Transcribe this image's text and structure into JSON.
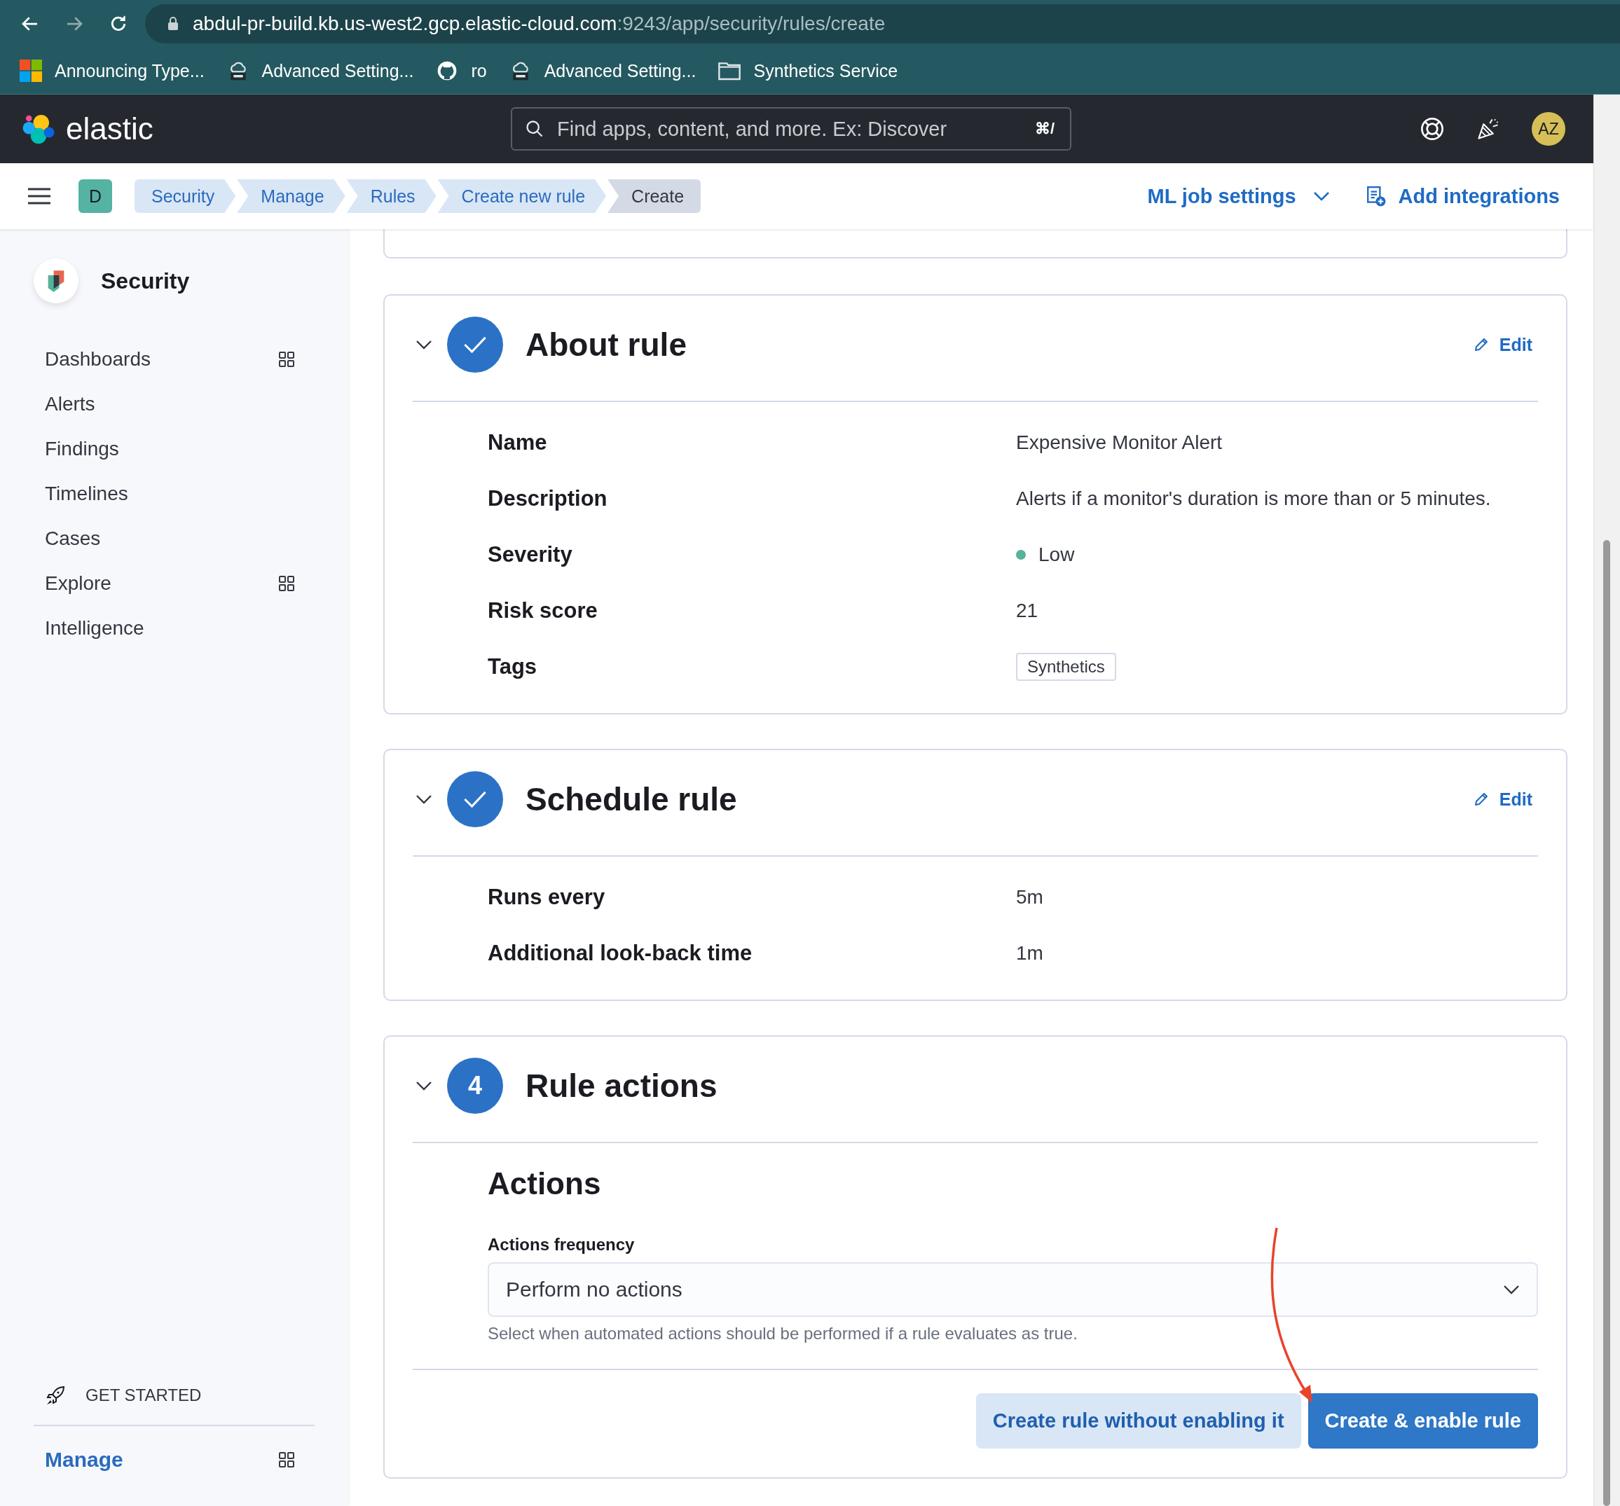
{
  "browser": {
    "url_host": "abdul-pr-build.kb.us-west2.gcp.elastic-cloud.com",
    "url_path": ":9243/app/security/rules/create",
    "bookmarks": [
      {
        "label": "Announcing Type...",
        "kind": "tiles"
      },
      {
        "label": "Advanced Setting...",
        "kind": "dev"
      },
      {
        "label": "ro",
        "kind": "github"
      },
      {
        "label": "Advanced Setting...",
        "kind": "dev"
      },
      {
        "label": "Synthetics Service",
        "kind": "folder"
      }
    ]
  },
  "header": {
    "logo_text": "elastic",
    "search": {
      "placeholder": "Find apps, content, and more. Ex: Discover",
      "shortcut": "⌘/"
    },
    "avatar": "AZ"
  },
  "breadcrumb_bar": {
    "space": "D",
    "crumbs": [
      {
        "label": "Security",
        "selected": false
      },
      {
        "label": "Manage",
        "selected": false
      },
      {
        "label": "Rules",
        "selected": false
      },
      {
        "label": "Create new rule",
        "selected": false
      },
      {
        "label": "Create",
        "selected": true
      }
    ],
    "links": [
      {
        "label": "ML job settings",
        "kind": "dropdown"
      },
      {
        "label": "Add integrations",
        "kind": "integrations"
      }
    ]
  },
  "sidebar": {
    "title": "Security",
    "items": [
      {
        "label": "Dashboards",
        "grid": true
      },
      {
        "label": "Alerts",
        "grid": false
      },
      {
        "label": "Findings",
        "grid": false
      },
      {
        "label": "Timelines",
        "grid": false
      },
      {
        "label": "Cases",
        "grid": false
      },
      {
        "label": "Explore",
        "grid": true
      },
      {
        "label": "Intelligence",
        "grid": false
      }
    ],
    "get_started": "GET STARTED",
    "manage": {
      "label": "Manage",
      "selected": true,
      "grid": true
    }
  },
  "sections": [
    {
      "title": "About rule",
      "completed": true,
      "edit": "Edit",
      "fields": [
        {
          "label": "Name",
          "value": "Expensive Monitor Alert",
          "kind": "text"
        },
        {
          "label": "Description",
          "value": "Alerts if a monitor's duration is more than or 5 minutes.",
          "kind": "text"
        },
        {
          "label": "Severity",
          "value": "Low",
          "kind": "severity",
          "color": "#54b399"
        },
        {
          "label": "Risk score",
          "value": "21",
          "kind": "text"
        },
        {
          "label": "Tags",
          "value": "Synthetics",
          "kind": "tag"
        }
      ]
    },
    {
      "title": "Schedule rule",
      "completed": true,
      "edit": "Edit",
      "fields": [
        {
          "label": "Runs every",
          "value": "5m",
          "kind": "text"
        },
        {
          "label": "Additional look-back time",
          "value": "1m",
          "kind": "text"
        }
      ]
    },
    {
      "title": "Rule actions",
      "completed": false,
      "step": "4",
      "actions": {
        "heading": "Actions",
        "frequency_label": "Actions frequency",
        "frequency_value": "Perform no actions",
        "help": "Select when automated actions should be performed if a rule evaluates as true."
      },
      "buttons": [
        {
          "label": "Create rule without enabling it",
          "kind": "secondary"
        },
        {
          "label": "Create & enable rule",
          "kind": "primary"
        }
      ]
    }
  ]
}
